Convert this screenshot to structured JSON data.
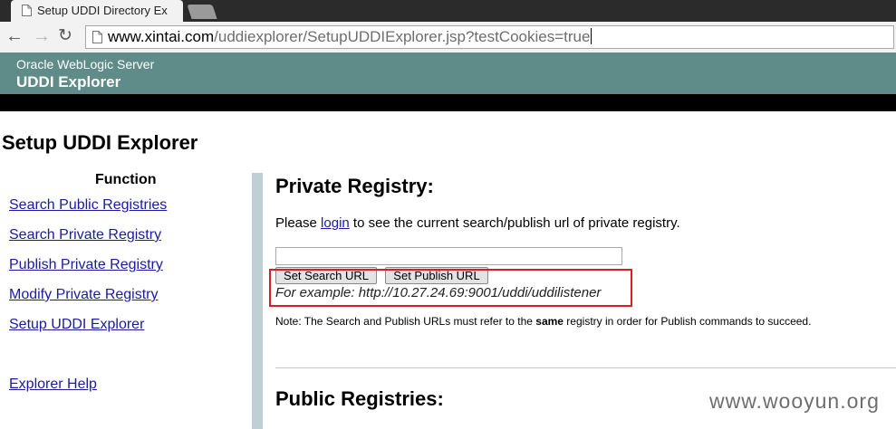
{
  "browser": {
    "tab_title": "Setup UDDI Directory Ex",
    "tab_close": "×",
    "url_host": "www.xintai.com",
    "url_rest": "/uddiexplorer/SetupUDDIExplorer.jsp?testCookies=true",
    "nav": {
      "back": "←",
      "forward": "→",
      "reload": "↻"
    }
  },
  "header": {
    "subtitle": "Oracle WebLogic Server",
    "title": "UDDI Explorer",
    "background_color": "#5f8c89"
  },
  "page": {
    "title": "Setup UDDI Explorer"
  },
  "sidebar": {
    "heading": "Function",
    "links": [
      {
        "label": "Search Public Registries"
      },
      {
        "label": "Search Private Registry"
      },
      {
        "label": "Publish Private Registry"
      },
      {
        "label": "Modify Private Registry"
      },
      {
        "label": "Setup UDDI Explorer"
      }
    ],
    "help_label": "Explorer Help"
  },
  "private_registry": {
    "title": "Private Registry:",
    "please": "Please ",
    "login_label": "login",
    "login_rest": " to see the current search/publish url of private registry.",
    "input_value": "",
    "set_search_label": "Set Search URL",
    "set_publish_label": "Set Publish URL",
    "example": "For example: http://10.27.24.69:9001/uddi/uddilistener",
    "note_prefix": "Note: The Search and Publish URLs must refer to the ",
    "note_bold": "same",
    "note_suffix": " registry in order for Publish commands to succeed."
  },
  "public_registries": {
    "title": "Public Registries:"
  },
  "watermark": "www.wooyun.org"
}
